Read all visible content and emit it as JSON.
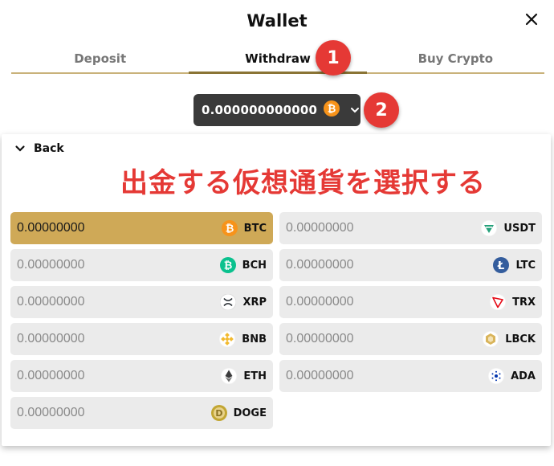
{
  "modal": {
    "title": "Wallet"
  },
  "tabs": [
    {
      "label": "Deposit"
    },
    {
      "label": "Withdraw"
    },
    {
      "label": "Buy Crypto"
    }
  ],
  "callouts": {
    "one": "1",
    "two": "2"
  },
  "balance": {
    "value": "0.000000000000",
    "coin_icon": "btc-icon"
  },
  "panel": {
    "back_label": "Back",
    "annotation": "出金する仮想通貨を選択する"
  },
  "coins": {
    "left": [
      {
        "amount": "0.00000000",
        "symbol": "BTC",
        "icon": "btc-icon",
        "color": "#f7931a",
        "selected": true
      },
      {
        "amount": "0.00000000",
        "symbol": "BCH",
        "icon": "bch-icon",
        "color": "#0ac18e"
      },
      {
        "amount": "0.00000000",
        "symbol": "XRP",
        "icon": "xrp-icon",
        "color": "#23292f"
      },
      {
        "amount": "0.00000000",
        "symbol": "BNB",
        "icon": "bnb-icon",
        "color": "#f3ba2f"
      },
      {
        "amount": "0.00000000",
        "symbol": "ETH",
        "icon": "eth-icon",
        "color": "#3c3c3d"
      },
      {
        "amount": "0.00000000",
        "symbol": "DOGE",
        "icon": "doge-icon",
        "color": "#c2a633"
      }
    ],
    "right": [
      {
        "amount": "0.00000000",
        "symbol": "USDT",
        "icon": "usdt-icon",
        "color": "#26a17b"
      },
      {
        "amount": "0.00000000",
        "symbol": "LTC",
        "icon": "ltc-icon",
        "color": "#345d9d"
      },
      {
        "amount": "0.00000000",
        "symbol": "TRX",
        "icon": "trx-icon",
        "color": "#e50915"
      },
      {
        "amount": "0.00000000",
        "symbol": "LBCK",
        "icon": "lbck-icon",
        "color": "#d9b45a"
      },
      {
        "amount": "0.00000000",
        "symbol": "ADA",
        "icon": "ada-icon",
        "color": "#0033ad"
      }
    ]
  },
  "colors": {
    "accent": "#cfa957",
    "callout": "#e53935",
    "dark": "#3a3a3a"
  }
}
